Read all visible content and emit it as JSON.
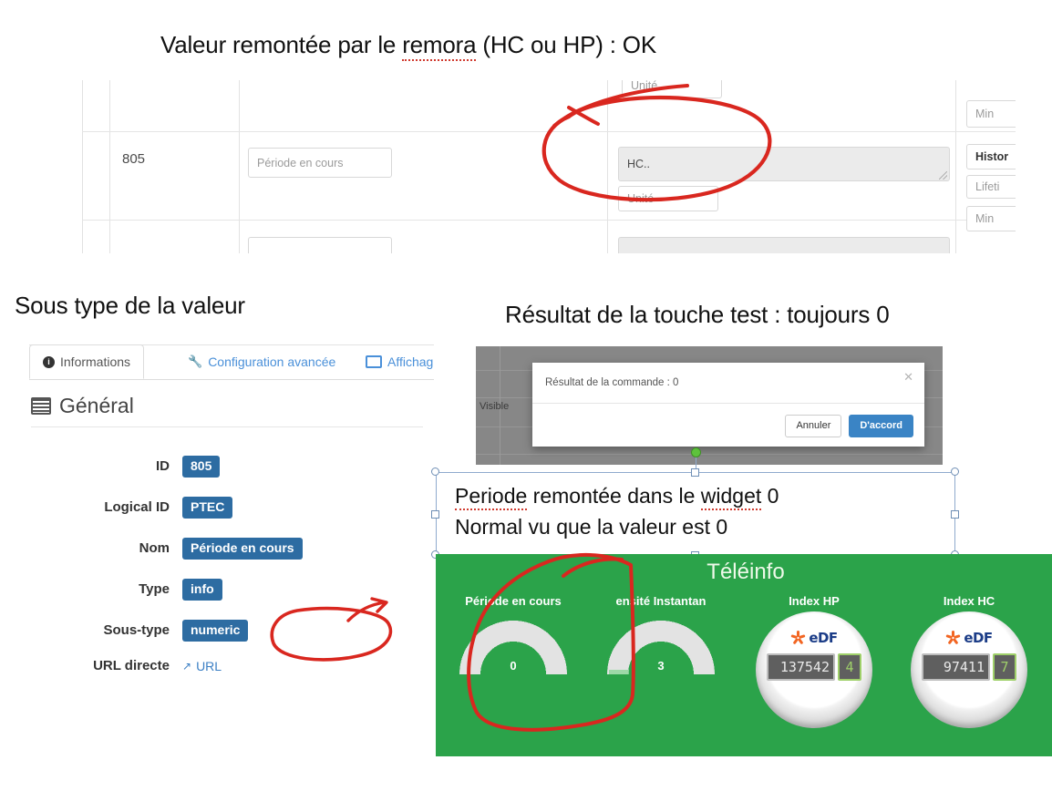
{
  "slide": {
    "headings": {
      "top": {
        "before": "Valeur remontée par le ",
        "spell": "remora",
        "after": " (HC ou HP) : OK"
      },
      "subtype": "Sous type de la valeur",
      "result": "Résultat de la touche test : toujours 0"
    }
  },
  "top_screenshot": {
    "row_partial_top": {
      "unit_placeholder": "Unité"
    },
    "row": {
      "id": "805",
      "name_value": "Période en cours",
      "value_textarea": "HC..",
      "unit_placeholder": "Unité"
    },
    "right_buttons": {
      "min_above": "Min",
      "historique": "Histor",
      "lifetime": "Lifeti",
      "min": "Min"
    }
  },
  "info_panel": {
    "tabs": [
      {
        "label": "Informations",
        "icon": "info-circle-icon",
        "active": true
      },
      {
        "label": "Configuration avancée",
        "icon": "wrench-icon",
        "active": false
      },
      {
        "label": "Affichag",
        "icon": "monitor-icon",
        "active": false
      }
    ],
    "section_title": "Général",
    "section_icon": "list-icon",
    "fields": [
      {
        "label": "ID",
        "value": "805"
      },
      {
        "label": "Logical ID",
        "value": "PTEC"
      },
      {
        "label": "Nom",
        "value": "Période en cours"
      },
      {
        "label": "Type",
        "value": "info"
      },
      {
        "label": "Sous-type",
        "value": "numeric"
      }
    ],
    "url_row": {
      "label": "URL directe",
      "link_text": "URL",
      "icon": "external-link-icon"
    }
  },
  "modal_screenshot": {
    "background_label": "Visible",
    "title": "Résultat de la commande : 0",
    "close_icon": "close-icon",
    "cancel_label": "Annuler",
    "confirm_label": "D'accord"
  },
  "textbox": {
    "line1": {
      "spell1": "Periode",
      "mid": " remontée dans le ",
      "spell2": "widget",
      "after": " 0"
    },
    "line2": "Normal vu que la valeur est 0"
  },
  "teleinfo": {
    "title": "Téléinfo",
    "background_color": "#2ba34a",
    "columns": [
      {
        "label": "Période en cours",
        "kind": "gauge",
        "value": "0"
      },
      {
        "label": "ensité Instantan",
        "kind": "gauge",
        "value": "3"
      },
      {
        "label": "Index HP",
        "kind": "meter",
        "brand": "eDF",
        "digits": "137542",
        "last_digit": "4"
      },
      {
        "label": "Index HC",
        "kind": "meter",
        "brand": "eDF",
        "digits": "97411",
        "last_digit": "7"
      }
    ]
  },
  "annotations": {
    "ink_color": "#d9271f",
    "marks": [
      "ellipse-around-hc-value",
      "arrow-to-hc-value",
      "ellipse-around-numeric-badge",
      "arrow-to-numeric-badge",
      "lasso-around-periode-en-cours-gauge"
    ]
  }
}
